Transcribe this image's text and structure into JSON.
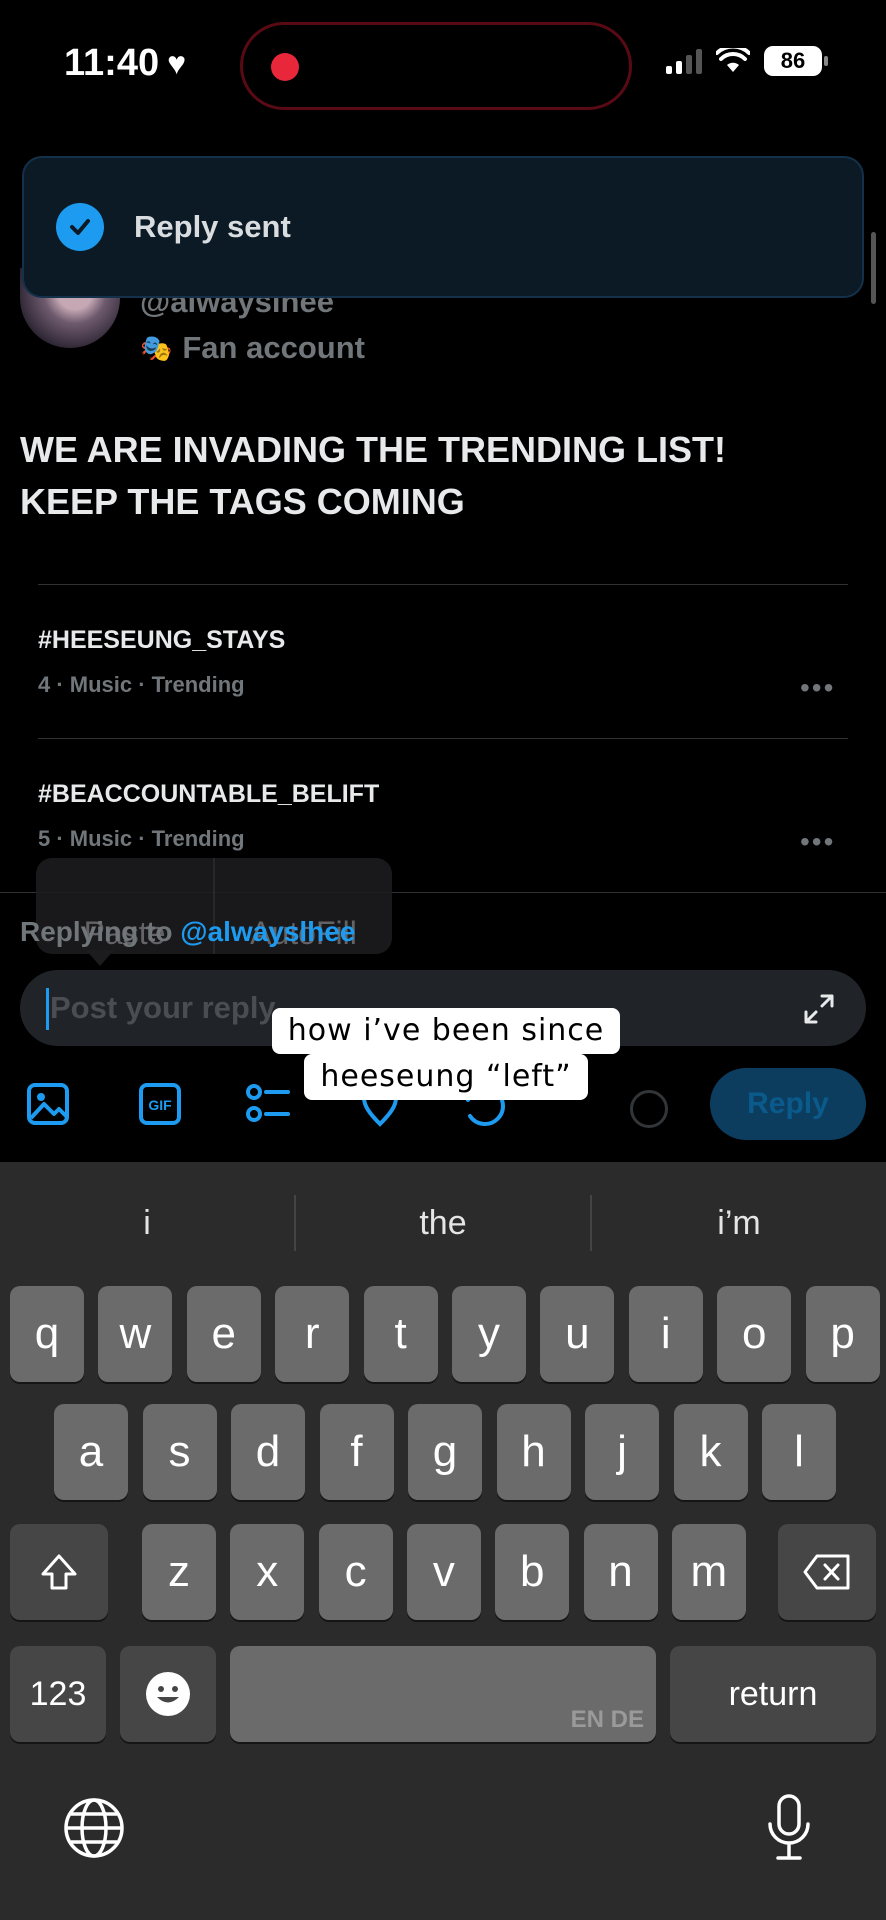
{
  "status_bar": {
    "time": "11:40",
    "battery": "86"
  },
  "toast": {
    "text": "Reply sent"
  },
  "tweet": {
    "handle": "@alwayslhee",
    "account_label": "Fan account",
    "text_lines": [
      "WE ARE INVADING THE TRENDING LIST!",
      "KEEP THE TAGS COMING"
    ]
  },
  "trends": [
    {
      "tag": "#HEESEUNG_STAYS",
      "meta": "4 · Music · Trending",
      "more": "•••"
    },
    {
      "tag": "#BEACCOUNTABLE_BELIFT",
      "meta": "5 · Music · Trending",
      "more": "•••"
    }
  ],
  "edit_menu": {
    "paste": "Paste",
    "autofill": "AutoFill"
  },
  "reply": {
    "replying_to_label": "Replying to",
    "mention": "@alwayslhee",
    "placeholder": "Post your reply",
    "button": "Reply"
  },
  "caption": {
    "line1": "how i’ve been since",
    "line2": "heeseung “left”"
  },
  "toolbar_icons": [
    "image-icon",
    "gif-icon",
    "poll-icon",
    "location-icon",
    "schedule-icon"
  ],
  "gif_label": "GIF",
  "keyboard": {
    "suggestions": [
      "i",
      "the",
      "i’m"
    ],
    "row1": [
      "q",
      "w",
      "e",
      "r",
      "t",
      "y",
      "u",
      "i",
      "o",
      "p"
    ],
    "row2": [
      "a",
      "s",
      "d",
      "f",
      "g",
      "h",
      "j",
      "k",
      "l"
    ],
    "row3": [
      "z",
      "x",
      "c",
      "v",
      "b",
      "n",
      "m"
    ],
    "numbers_key": "123",
    "return_key": "return",
    "languages": "EN DE"
  },
  "colors": {
    "accent": "#1d9bf0",
    "background": "#000000",
    "keyboard_bg": "#2b2b2b",
    "key": "#6b6b6b",
    "toast_bg": "#0b1a25",
    "recording": "#e8283a"
  }
}
